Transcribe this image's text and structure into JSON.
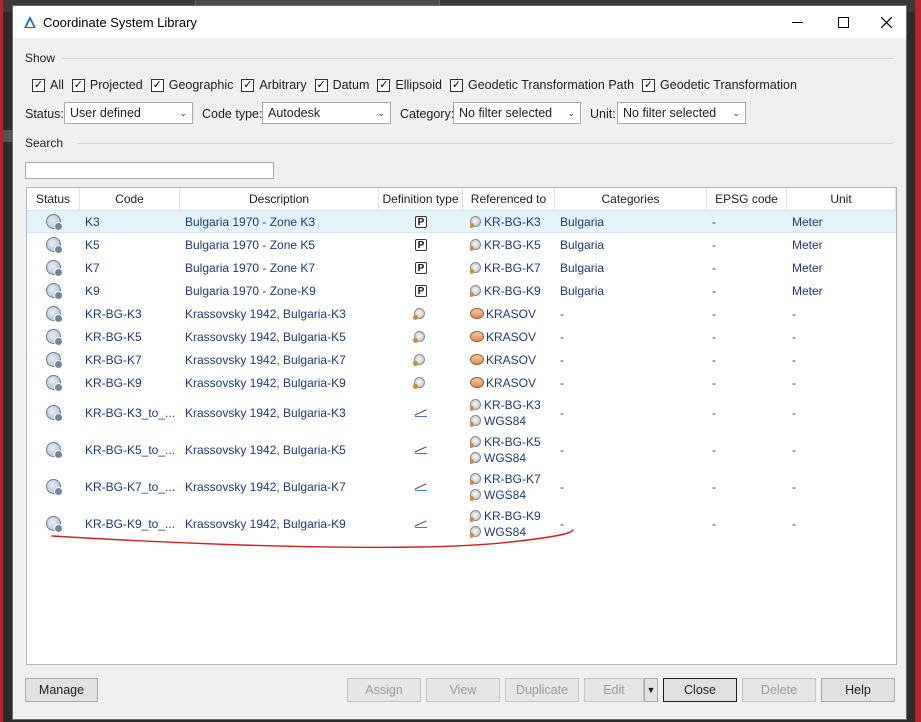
{
  "window": {
    "title": "Coordinate System Library"
  },
  "show": {
    "label": "Show",
    "checkboxes": [
      {
        "label": "All",
        "checked": true
      },
      {
        "label": "Projected",
        "checked": true
      },
      {
        "label": "Geographic",
        "checked": true
      },
      {
        "label": "Arbitrary",
        "checked": true
      },
      {
        "label": "Datum",
        "checked": true
      },
      {
        "label": "Ellipsoid",
        "checked": true
      },
      {
        "label": "Geodetic Transformation Path",
        "checked": true
      },
      {
        "label": "Geodetic Transformation",
        "checked": true
      }
    ]
  },
  "filters": {
    "status_label": "Status:",
    "status_value": "User defined",
    "code_type_label": "Code type:",
    "code_type_value": "Autodesk",
    "category_label": "Category:",
    "category_value": "No filter selected",
    "unit_label": "Unit:",
    "unit_value": "No filter selected"
  },
  "search": {
    "label": "Search",
    "value": ""
  },
  "table": {
    "columns": [
      "Status",
      "Code",
      "Description",
      "Definition type",
      "Referenced to",
      "Categories",
      "EPSG code",
      "Unit"
    ],
    "rows": [
      {
        "code": "K3",
        "description": "Bulgaria 1970 - Zone K3",
        "def": "projected-icon",
        "ref": [
          "KR-BG-K3"
        ],
        "ref_icon": "globe-icon",
        "category": "Bulgaria",
        "epsg": "-",
        "unit": "Meter",
        "selected": true
      },
      {
        "code": "K5",
        "description": "Bulgaria 1970 - Zone K5",
        "def": "projected-icon",
        "ref": [
          "KR-BG-K5"
        ],
        "ref_icon": "globe-icon",
        "category": "Bulgaria",
        "epsg": "-",
        "unit": "Meter"
      },
      {
        "code": "K7",
        "description": "Bulgaria 1970 - Zone K7",
        "def": "projected-icon",
        "ref": [
          "KR-BG-K7"
        ],
        "ref_icon": "globe-icon",
        "category": "Bulgaria",
        "epsg": "-",
        "unit": "Meter"
      },
      {
        "code": "K9",
        "description": "Bulgaria 1970 - Zone-K9",
        "def": "projected-icon",
        "ref": [
          "KR-BG-K9"
        ],
        "ref_icon": "globe-icon",
        "category": "Bulgaria",
        "epsg": "-",
        "unit": "Meter"
      },
      {
        "code": "KR-BG-K3",
        "description": "Krassovsky 1942, Bulgaria-K3",
        "def": "datum-icon",
        "ref": [
          "KRASOV"
        ],
        "ref_icon": "ellipsoid-icon",
        "category": "-",
        "epsg": "-",
        "unit": "-"
      },
      {
        "code": "KR-BG-K5",
        "description": "Krassovsky 1942, Bulgaria-K5",
        "def": "datum-icon",
        "ref": [
          "KRASOV"
        ],
        "ref_icon": "ellipsoid-icon",
        "category": "-",
        "epsg": "-",
        "unit": "-"
      },
      {
        "code": "KR-BG-K7",
        "description": "Krassovsky 1942, Bulgaria-K7",
        "def": "datum-icon",
        "ref": [
          "KRASOV"
        ],
        "ref_icon": "ellipsoid-icon",
        "category": "-",
        "epsg": "-",
        "unit": "-"
      },
      {
        "code": "KR-BG-K9",
        "description": "Krassovsky 1942, Bulgaria-K9",
        "def": "datum-icon",
        "ref": [
          "KRASOV"
        ],
        "ref_icon": "ellipsoid-icon",
        "category": "-",
        "epsg": "-",
        "unit": "-"
      },
      {
        "code": "KR-BG-K3_to_...",
        "description": "Krassovsky 1942, Bulgaria-K3",
        "def": "transformation-icon",
        "ref": [
          "KR-BG-K3",
          "WGS84"
        ],
        "ref_icon": "globe-icon",
        "category": "-",
        "epsg": "-",
        "unit": "-"
      },
      {
        "code": "KR-BG-K5_to_...",
        "description": "Krassovsky 1942, Bulgaria-K5",
        "def": "transformation-icon",
        "ref": [
          "KR-BG-K5",
          "WGS84"
        ],
        "ref_icon": "globe-icon",
        "category": "-",
        "epsg": "-",
        "unit": "-"
      },
      {
        "code": "KR-BG-K7_to_...",
        "description": "Krassovsky 1942, Bulgaria-K7",
        "def": "transformation-icon",
        "ref": [
          "KR-BG-K7",
          "WGS84"
        ],
        "ref_icon": "globe-icon",
        "category": "-",
        "epsg": "-",
        "unit": "-"
      },
      {
        "code": "KR-BG-K9_to_...",
        "description": "Krassovsky 1942, Bulgaria-K9",
        "def": "transformation-icon",
        "ref": [
          "KR-BG-K9",
          "WGS84"
        ],
        "ref_icon": "globe-icon",
        "category": "-",
        "epsg": "-",
        "unit": "-"
      }
    ]
  },
  "buttons": {
    "manage": "Manage",
    "assign": "Assign",
    "view": "View",
    "duplicate": "Duplicate",
    "edit": "Edit",
    "close": "Close",
    "delete": "Delete",
    "help": "Help"
  },
  "colors": {
    "link_blue": "#1d3a86",
    "selected_row": "#e5f3fb",
    "annotation_red": "#d41f1f"
  }
}
